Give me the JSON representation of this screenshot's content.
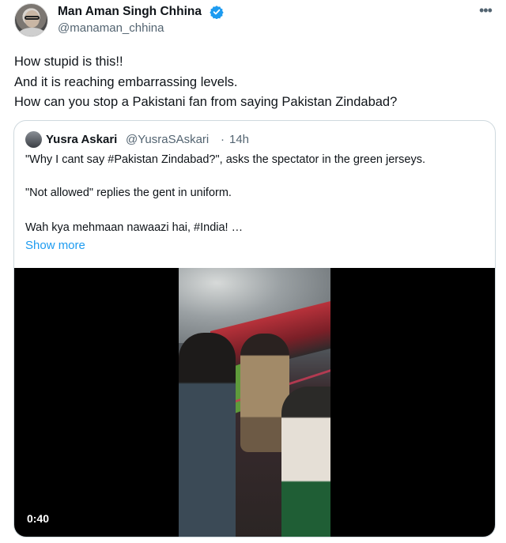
{
  "tweet": {
    "author_name": "Man Aman Singh Chhina",
    "author_handle": "@manaman_chhina",
    "verified_icon": "verified-badge-icon",
    "more_icon": "more-horizontal-icon",
    "text_lines": [
      "How stupid is this!!",
      "And it is reaching embarrassing levels.",
      "How can you stop a Pakistani fan from saying Pakistan Zindabad?"
    ]
  },
  "quote": {
    "author_name": "Yusra Askari",
    "author_handle": "@YusraSAskari",
    "separator": "·",
    "time": "14h",
    "lines": [
      "\"Why I cant say #Pakistan Zindabad?\", asks the spectator in the green jerseys.",
      "\"Not allowed\" replies the gent in uniform.",
      "Wah kya mehmaan nawaazi hai, #India! …"
    ],
    "show_more": "Show more",
    "video_duration": "0:40"
  },
  "colors": {
    "primary_text": "#0f1419",
    "secondary_text": "#536471",
    "link": "#1d9bf0",
    "border": "#cfd9de",
    "verified": "#1d9bf0"
  }
}
